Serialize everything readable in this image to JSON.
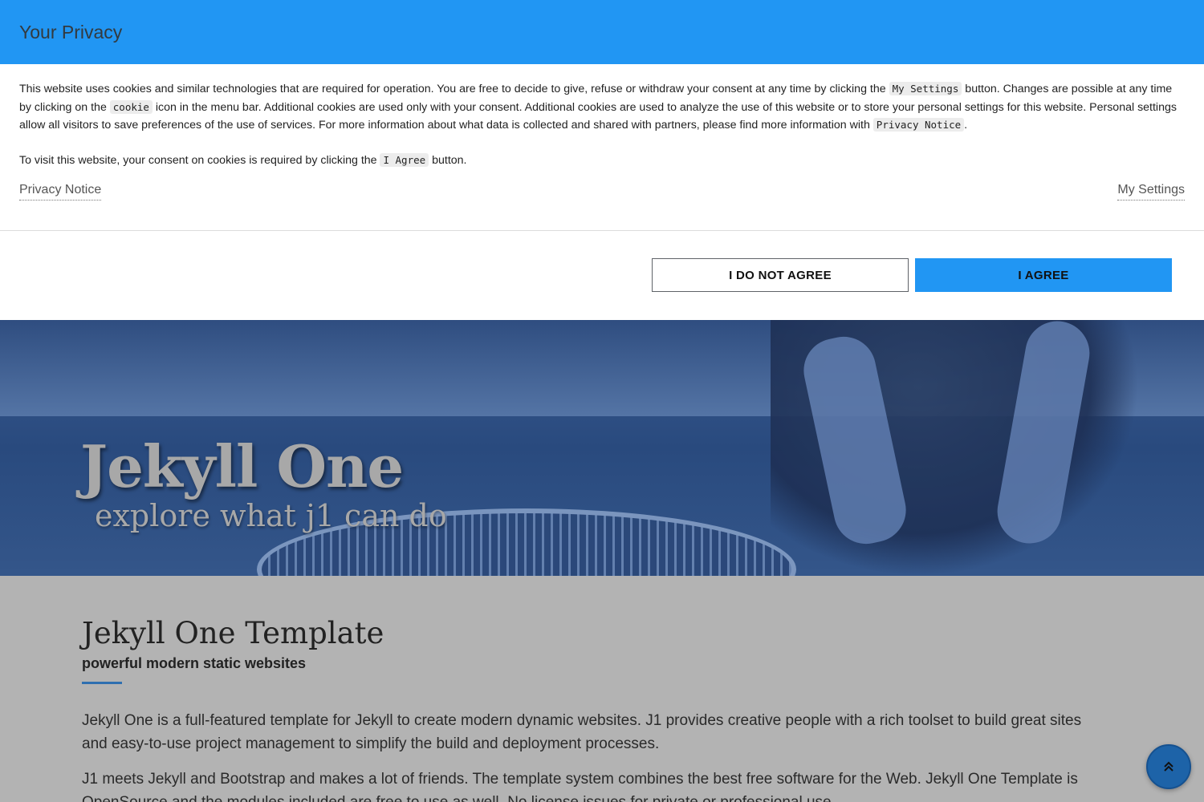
{
  "colors": {
    "accent": "#2196f3",
    "hero_overlay": "#2a4a7e",
    "content_background": "#b3b3b3",
    "scroll_button": "#1d63a8"
  },
  "privacy_modal": {
    "title": "Your Privacy",
    "paragraph1": {
      "t1": "This website uses cookies and similar technologies that are required for operation. You are free to decide to give, refuse or withdraw your consent at any time by clicking the ",
      "code1": "My Settings",
      "t2": " button. Changes are possible at any time by clicking on the ",
      "code2": "cookie",
      "t3": " icon in the menu bar. Additional cookies are used only with your consent. Additional cookies are used to analyze the use of this website or to store your personal settings for this website. Personal settings allow all visitors to save preferences of the use of services. For more information about what data is collected and shared with partners, please find more information with ",
      "code3": "Privacy Notice",
      "t4": "."
    },
    "paragraph2": {
      "t1": "To visit this website, your consent on cookies is required by clicking the ",
      "code1": "I Agree",
      "t2": " button."
    },
    "links": {
      "privacy_notice": "Privacy Notice",
      "my_settings": "My Settings"
    },
    "buttons": {
      "disagree": "I DO NOT AGREE",
      "agree": "I AGREE"
    }
  },
  "hero": {
    "title": "Jekyll One",
    "subtitle": "explore what j1 can do"
  },
  "content": {
    "title": "Jekyll One Template",
    "subtitle": "powerful modern static websites",
    "paragraph1": "Jekyll One is a full-featured template for Jekyll to create modern dynamic websites. J1 provides creative people with a rich toolset to build great sites and easy-to-use project management to simplify the build and deployment processes.",
    "paragraph2": "J1 meets Jekyll and Bootstrap and makes a lot of friends. The template system combines the best free software for the Web. Jekyll One Template is OpenSource and the modules included are free to use as well. No license issues for private or professional use."
  },
  "scroll_top": {
    "icon": "double-chevron-up-icon",
    "glyph": "⌃"
  }
}
